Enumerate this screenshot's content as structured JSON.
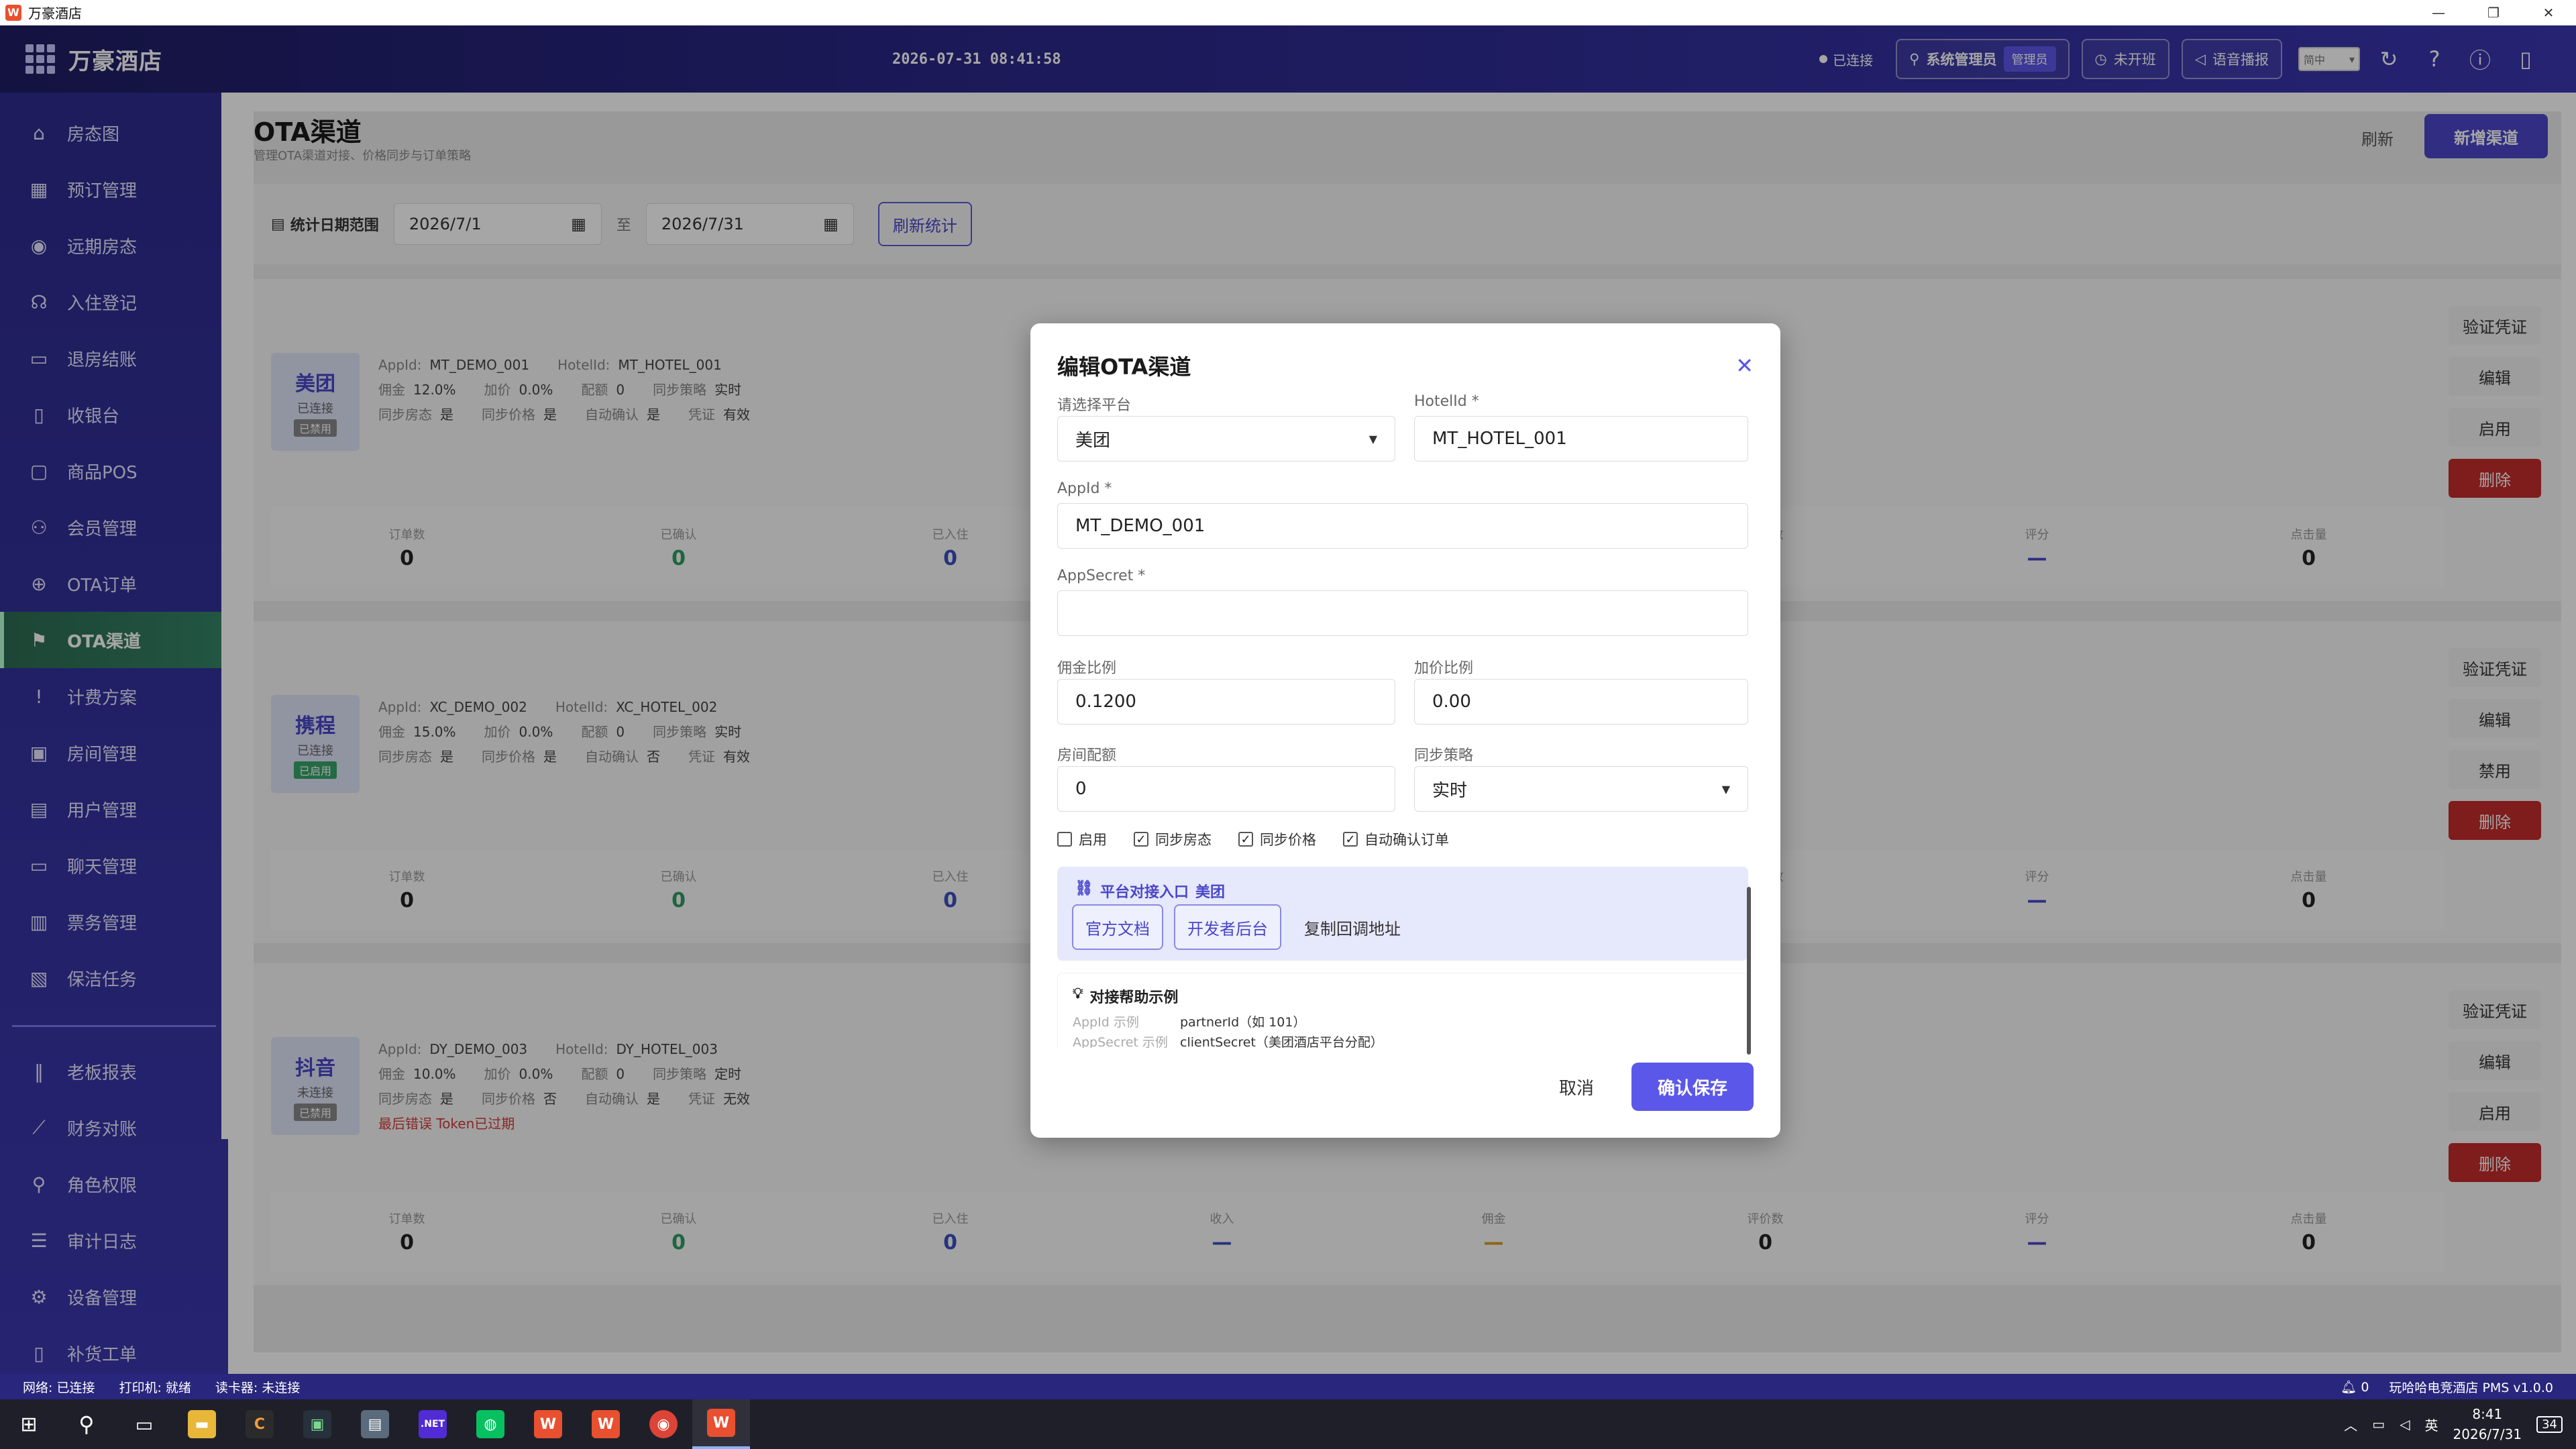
{
  "window": {
    "title": "万豪酒店",
    "controls": [
      "—",
      "❐",
      "✕"
    ]
  },
  "header": {
    "brand": "万豪酒店",
    "clock": "2026-07-31 08:41:58",
    "connection": "已连接",
    "user": "系统管理员",
    "role": "管理员",
    "shift": "未开班",
    "voice": "语音播报",
    "lang": "简中"
  },
  "sidebar": {
    "items": [
      {
        "label": "房态图",
        "icon": "⌂"
      },
      {
        "label": "预订管理",
        "icon": "▦"
      },
      {
        "label": "远期房态",
        "icon": "◉"
      },
      {
        "label": "入住登记",
        "icon": "☊"
      },
      {
        "label": "退房结账",
        "icon": "▭"
      },
      {
        "label": "收银台",
        "icon": "▯"
      },
      {
        "label": "商品POS",
        "icon": "▢"
      },
      {
        "label": "会员管理",
        "icon": "⚇"
      },
      {
        "label": "OTA订单",
        "icon": "⊕"
      },
      {
        "label": "OTA渠道",
        "icon": "⚑"
      },
      {
        "label": "计费方案",
        "icon": "!"
      },
      {
        "label": "房间管理",
        "icon": "▣"
      },
      {
        "label": "用户管理",
        "icon": "▤"
      },
      {
        "label": "聊天管理",
        "icon": "▭"
      },
      {
        "label": "票务管理",
        "icon": "▥"
      },
      {
        "label": "保洁任务",
        "icon": "▧"
      }
    ],
    "items2": [
      {
        "label": "老板报表",
        "icon": "‖"
      },
      {
        "label": "财务对账",
        "icon": "⟋"
      },
      {
        "label": "角色权限",
        "icon": "⚲"
      },
      {
        "label": "审计日志",
        "icon": "☰"
      },
      {
        "label": "设备管理",
        "icon": "⚙"
      },
      {
        "label": "补货工单",
        "icon": "▯"
      }
    ]
  },
  "page": {
    "title": "OTA渠道",
    "subtitle": "管理OTA渠道对接、价格同步与订单策略",
    "refresh": "刷新",
    "new_channel": "新增渠道",
    "date_label": "统计日期范围",
    "date_from": "2026/7/1",
    "date_sep": "至",
    "date_to": "2026/7/31",
    "refresh_stats": "刷新统计"
  },
  "cards": [
    {
      "name": "美团",
      "status": "已连接",
      "tag": "已禁用",
      "appid": "MT_DEMO_001",
      "hotelid": "MT_HOTEL_001",
      "commission": "12.0%",
      "markup": "0.0%",
      "quota": "0",
      "strategy": "实时",
      "sync_room": "是",
      "sync_price": "是",
      "auto_confirm": "是",
      "credential": "有效",
      "enable_btn": "启用"
    },
    {
      "name": "携程",
      "status": "已连接",
      "tag": "已启用",
      "appid": "XC_DEMO_002",
      "hotelid": "XC_HOTEL_002",
      "commission": "15.0%",
      "markup": "0.0%",
      "quota": "0",
      "strategy": "实时",
      "sync_room": "是",
      "sync_price": "是",
      "auto_confirm": "否",
      "credential": "有效",
      "enable_btn": "禁用"
    },
    {
      "name": "抖音",
      "status": "未连接",
      "tag": "已禁用",
      "appid": "DY_DEMO_003",
      "hotelid": "DY_HOTEL_003",
      "commission": "10.0%",
      "markup": "0.0%",
      "quota": "0",
      "strategy": "定时",
      "sync_room": "是",
      "sync_price": "否",
      "auto_confirm": "是",
      "credential": "无效",
      "error": "最后错误 Token已过期",
      "enable_btn": "启用"
    }
  ],
  "card_labels": {
    "appid": "AppId:",
    "hotelid": "HotelId:",
    "commission": "佣金",
    "markup": "加价",
    "quota": "配额",
    "strategy": "同步策略",
    "sync_room": "同步房态",
    "sync_price": "同步价格",
    "auto_confirm": "自动确认",
    "credential": "凭证",
    "verify": "验证凭证",
    "edit": "编辑",
    "delete": "删除"
  },
  "stats": {
    "labels": [
      "订单数",
      "已确认",
      "已入住",
      "收入",
      "佣金",
      "评价数",
      "评分",
      "点击量"
    ],
    "values": [
      "0",
      "0",
      "0",
      "—",
      "—",
      "0",
      "—",
      "0"
    ]
  },
  "dialog": {
    "title": "编辑OTA渠道",
    "platform_label": "请选择平台",
    "platform_value": "美团",
    "hotelid_label": "HotelId *",
    "hotelid_value": "MT_HOTEL_001",
    "appid_label": "AppId *",
    "appid_value": "MT_DEMO_001",
    "secret_label": "AppSecret *",
    "secret_value": "",
    "commission_label": "佣金比例",
    "commission_value": "0.1200",
    "markup_label": "加价比例",
    "markup_value": "0.00",
    "quota_label": "房间配额",
    "quota_value": "0",
    "strategy_label": "同步策略",
    "strategy_value": "实时",
    "checks": [
      {
        "label": "启用",
        "checked": false
      },
      {
        "label": "同步房态",
        "checked": true
      },
      {
        "label": "同步价格",
        "checked": true
      },
      {
        "label": "自动确认订单",
        "checked": true
      }
    ],
    "entry_title": "平台对接入口",
    "entry_platform": "美团",
    "doc_btn": "官方文档",
    "dev_btn": "开发者后台",
    "copy_btn": "复制回调地址",
    "help_title": "对接帮助示例",
    "help_rows": [
      {
        "k": "AppId 示例",
        "v": "partnerId（如 101）"
      },
      {
        "k": "AppSecret 示例",
        "v": "clientSecret（美团酒店平台分配）"
      }
    ],
    "cancel": "取消",
    "save": "确认保存"
  },
  "statusbar": {
    "network": "网络: 已连接",
    "printer": "打印机: 就绪",
    "reader": "读卡器: 未连接",
    "notify": "0",
    "version": "玩哈哈电竞酒店 PMS v1.0.0"
  },
  "taskbar": {
    "ime": "英",
    "time": "8:41",
    "date": "2026/7/31",
    "badge": "34"
  }
}
